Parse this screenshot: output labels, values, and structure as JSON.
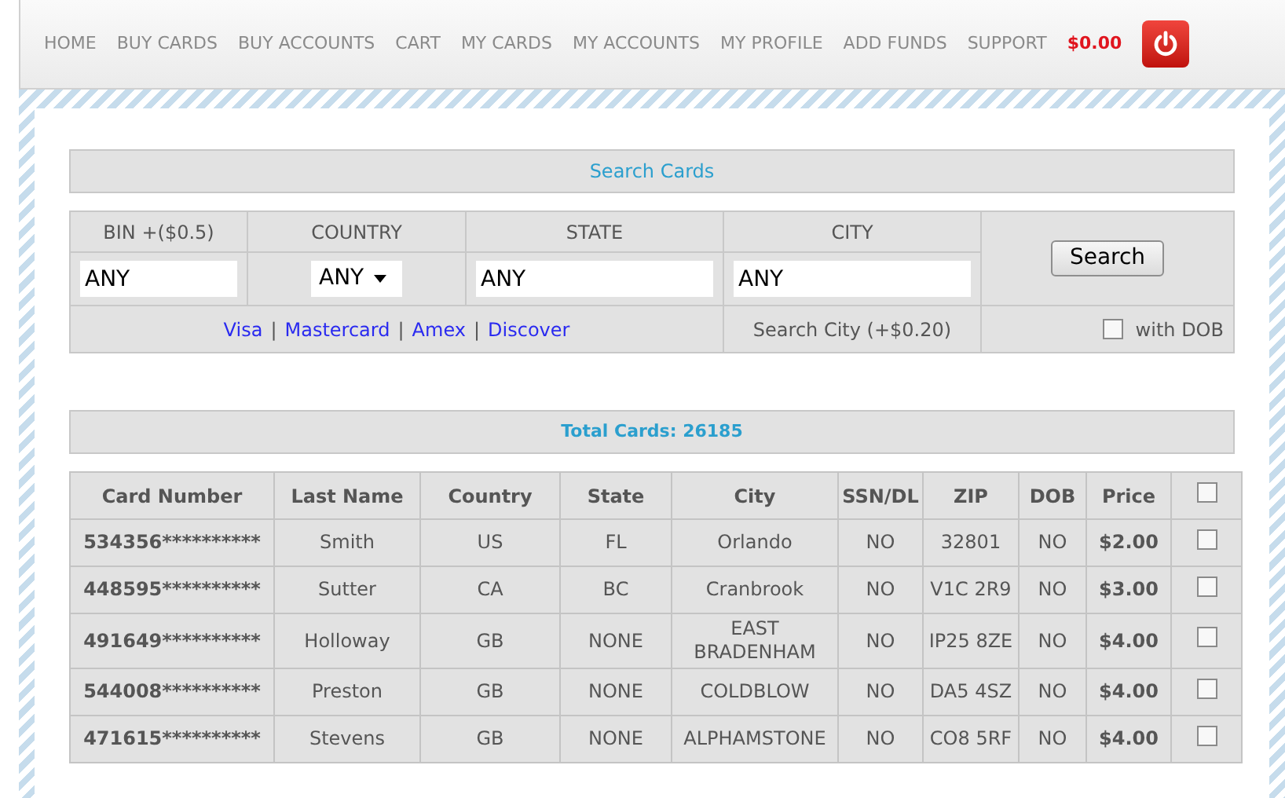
{
  "nav": {
    "items": [
      {
        "label": "HOME"
      },
      {
        "label": "BUY CARDS"
      },
      {
        "label": "BUY ACCOUNTS"
      },
      {
        "label": "CART"
      },
      {
        "label": "MY CARDS"
      },
      {
        "label": "MY ACCOUNTS"
      },
      {
        "label": "MY PROFILE"
      },
      {
        "label": "ADD FUNDS"
      },
      {
        "label": "SUPPORT"
      }
    ],
    "balance": "$0.00"
  },
  "search": {
    "title": "Search Cards",
    "fields": [
      {
        "label": "BIN +($0.5)",
        "kind": "text",
        "value": "ANY"
      },
      {
        "label": "COUNTRY",
        "kind": "select",
        "value": "ANY"
      },
      {
        "label": "STATE",
        "kind": "text",
        "value": "ANY"
      },
      {
        "label": "CITY",
        "kind": "text",
        "value": "ANY"
      }
    ],
    "button": "Search",
    "brands": [
      "Visa",
      "Mastercard",
      "Amex",
      "Discover"
    ],
    "separator": "|",
    "city_note": "Search City (+$0.20)",
    "with_dob": {
      "label": "with DOB",
      "checked": false
    }
  },
  "total": "Total Cards: 26185",
  "table": {
    "columns": [
      "Card Number",
      "Last Name",
      "Country",
      "State",
      "City",
      "SSN/DL",
      "ZIP",
      "DOB",
      "Price"
    ],
    "select_all": false,
    "rows": [
      {
        "cells": [
          "534356**********",
          "Smith",
          "US",
          "FL",
          "Orlando",
          "NO",
          "32801",
          "NO",
          "$2.00"
        ],
        "checked": false
      },
      {
        "cells": [
          "448595**********",
          "Sutter",
          "CA",
          "BC",
          "Cranbrook",
          "NO",
          "V1C 2R9",
          "NO",
          "$3.00"
        ],
        "checked": false
      },
      {
        "cells": [
          "491649**********",
          "Holloway",
          "GB",
          "NONE",
          "EAST BRADENHAM",
          "NO",
          "IP25 8ZE",
          "NO",
          "$4.00"
        ],
        "checked": false
      },
      {
        "cells": [
          "544008**********",
          "Preston",
          "GB",
          "NONE",
          "COLDBLOW",
          "NO",
          "DA5 4SZ",
          "NO",
          "$4.00"
        ],
        "checked": false
      },
      {
        "cells": [
          "471615**********",
          "Stevens",
          "GB",
          "NONE",
          "ALPHAMSTONE",
          "NO",
          "CO8 5RF",
          "NO",
          "$4.00"
        ],
        "checked": false
      }
    ]
  }
}
